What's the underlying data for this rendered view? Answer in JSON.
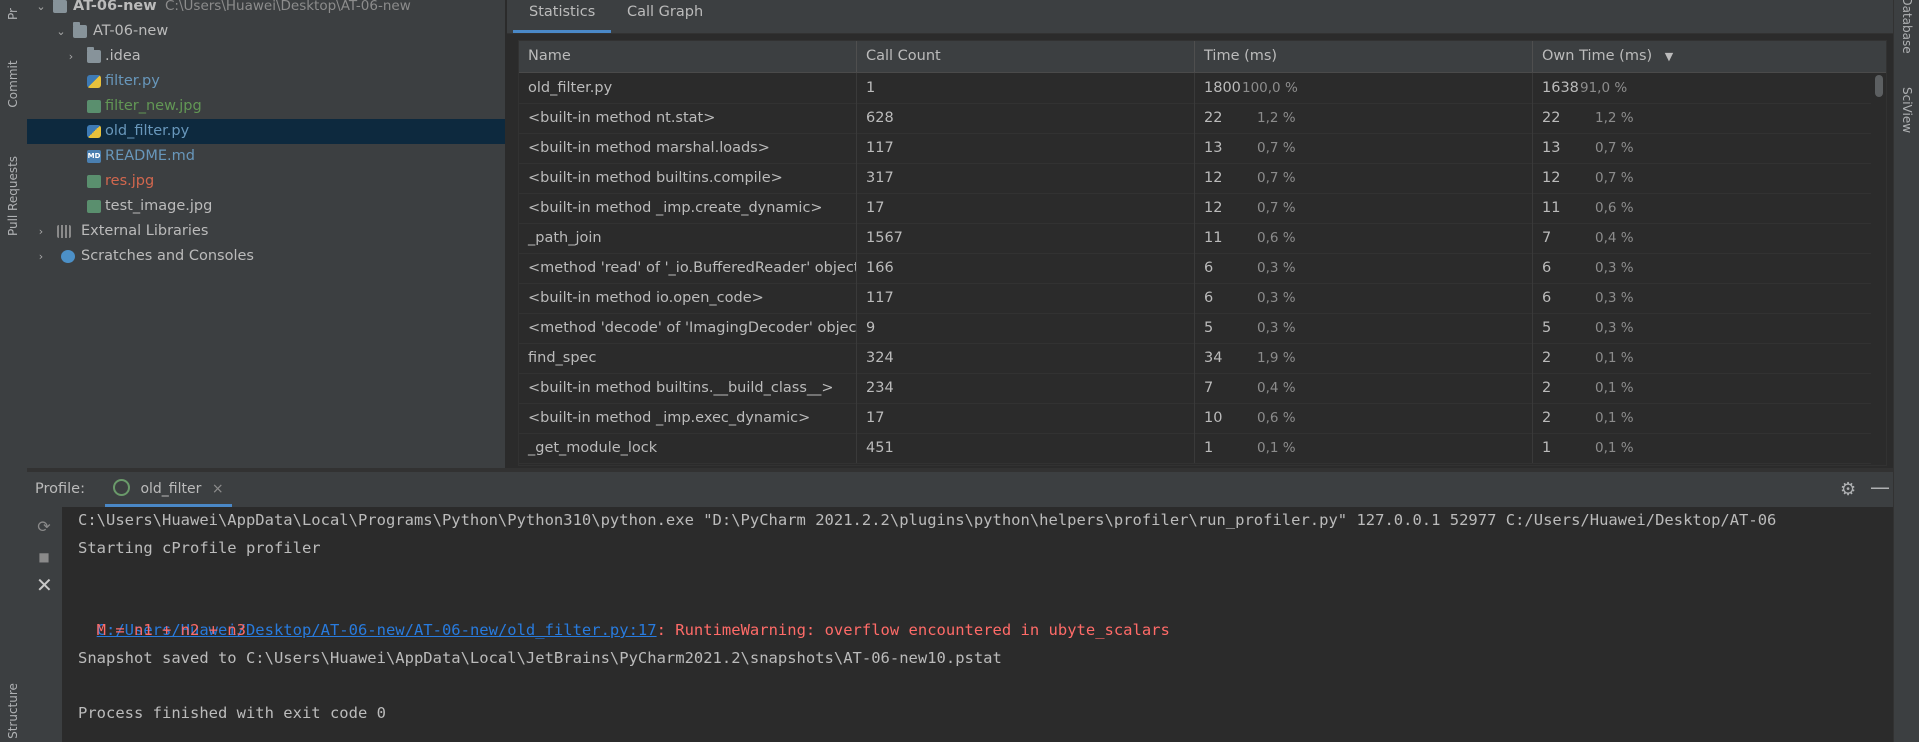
{
  "left_tool_strip": {
    "tabs": [
      "Pr",
      "Commit",
      "Pull Requests",
      "Structure"
    ]
  },
  "right_tool_strip": {
    "tabs": [
      "Database",
      "SciView"
    ]
  },
  "project_tree": {
    "root": {
      "label": "AT-06-new",
      "path": "C:\\Users\\Huawei\\Desktop\\AT-06-new"
    },
    "items": [
      {
        "label": "AT-06-new",
        "icon": "folder-icon",
        "color": "#bbbbbb"
      },
      {
        "label": ".idea",
        "icon": "folder-icon",
        "color": "#bbbbbb"
      },
      {
        "label": "filter.py",
        "icon": "python-file-icon",
        "color": "#6897bb"
      },
      {
        "label": "filter_new.jpg",
        "icon": "image-file-icon",
        "color": "#629755"
      },
      {
        "label": "old_filter.py",
        "icon": "python-file-icon",
        "color": "#6897bb"
      },
      {
        "label": "README.md",
        "icon": "markdown-file-icon",
        "color": "#6897bb"
      },
      {
        "label": "res.jpg",
        "icon": "image-file-icon",
        "color": "#d2674e"
      },
      {
        "label": "test_image.jpg",
        "icon": "image-file-icon",
        "color": "#bbbbbb"
      },
      {
        "label": "External Libraries",
        "icon": "library-icon",
        "color": "#bbbbbb"
      },
      {
        "label": "Scratches and Consoles",
        "icon": "scratches-icon",
        "color": "#bbbbbb"
      }
    ],
    "selected": "old_filter.py"
  },
  "profiler_tabs": [
    "Statistics",
    "Call Graph"
  ],
  "stats_table": {
    "columns": [
      "Name",
      "Call Count",
      "Time (ms)",
      "Own Time (ms)"
    ],
    "sort_indicator": "▼",
    "rows": [
      {
        "name": "old_filter.py",
        "count": "1",
        "time": "1800",
        "time_pct": "100,0 %",
        "own": "1638",
        "own_pct": "91,0 %"
      },
      {
        "name": "<built-in method nt.stat>",
        "count": "628",
        "time": "22",
        "time_pct": "1,2 %",
        "own": "22",
        "own_pct": "1,2 %"
      },
      {
        "name": "<built-in method marshal.loads>",
        "count": "117",
        "time": "13",
        "time_pct": "0,7 %",
        "own": "13",
        "own_pct": "0,7 %"
      },
      {
        "name": "<built-in method builtins.compile>",
        "count": "317",
        "time": "12",
        "time_pct": "0,7 %",
        "own": "12",
        "own_pct": "0,7 %"
      },
      {
        "name": "<built-in method _imp.create_dynamic>",
        "count": "17",
        "time": "12",
        "time_pct": "0,7 %",
        "own": "11",
        "own_pct": "0,6 %"
      },
      {
        "name": "_path_join",
        "count": "1567",
        "time": "11",
        "time_pct": "0,6 %",
        "own": "7",
        "own_pct": "0,4 %"
      },
      {
        "name": "<method 'read' of '_io.BufferedReader' objects>",
        "count": "166",
        "time": "6",
        "time_pct": "0,3 %",
        "own": "6",
        "own_pct": "0,3 %"
      },
      {
        "name": "<built-in method io.open_code>",
        "count": "117",
        "time": "6",
        "time_pct": "0,3 %",
        "own": "6",
        "own_pct": "0,3 %"
      },
      {
        "name": "<method 'decode' of 'ImagingDecoder' objects>",
        "count": "9",
        "time": "5",
        "time_pct": "0,3 %",
        "own": "5",
        "own_pct": "0,3 %"
      },
      {
        "name": "find_spec",
        "count": "324",
        "time": "34",
        "time_pct": "1,9 %",
        "own": "2",
        "own_pct": "0,1 %"
      },
      {
        "name": "<built-in method builtins.__build_class__>",
        "count": "234",
        "time": "7",
        "time_pct": "0,4 %",
        "own": "2",
        "own_pct": "0,1 %"
      },
      {
        "name": "<built-in method _imp.exec_dynamic>",
        "count": "17",
        "time": "10",
        "time_pct": "0,6 %",
        "own": "2",
        "own_pct": "0,1 %"
      },
      {
        "name": "_get_module_lock",
        "count": "451",
        "time": "1",
        "time_pct": "0,1 %",
        "own": "1",
        "own_pct": "0,1 %"
      }
    ]
  },
  "run_panel": {
    "label": "Profile:",
    "tab": "old_filter",
    "console": {
      "command": "C:\\Users\\Huawei\\AppData\\Local\\Programs\\Python\\Python310\\python.exe \"D:\\PyCharm 2021.2.2\\plugins\\python\\helpers\\profiler\\run_profiler.py\" 127.0.0.1 52977 C:/Users/Huawei/Desktop/AT-06",
      "starting": "Starting cProfile profiler",
      "warning_link": "C:/Users/Huawei/Desktop/AT-06-new/AT-06-new/old_filter.py:17",
      "warning_text": ": RuntimeWarning: overflow encountered in ubyte_scalars",
      "warning_code": "  M = n1 + n2 + n3",
      "snapshot": "Snapshot saved to C:\\Users\\Huawei\\AppData\\Local\\JetBrains\\PyCharm2021.2\\snapshots\\AT-06-new10.pstat",
      "finished": "Process finished with exit code 0"
    }
  }
}
